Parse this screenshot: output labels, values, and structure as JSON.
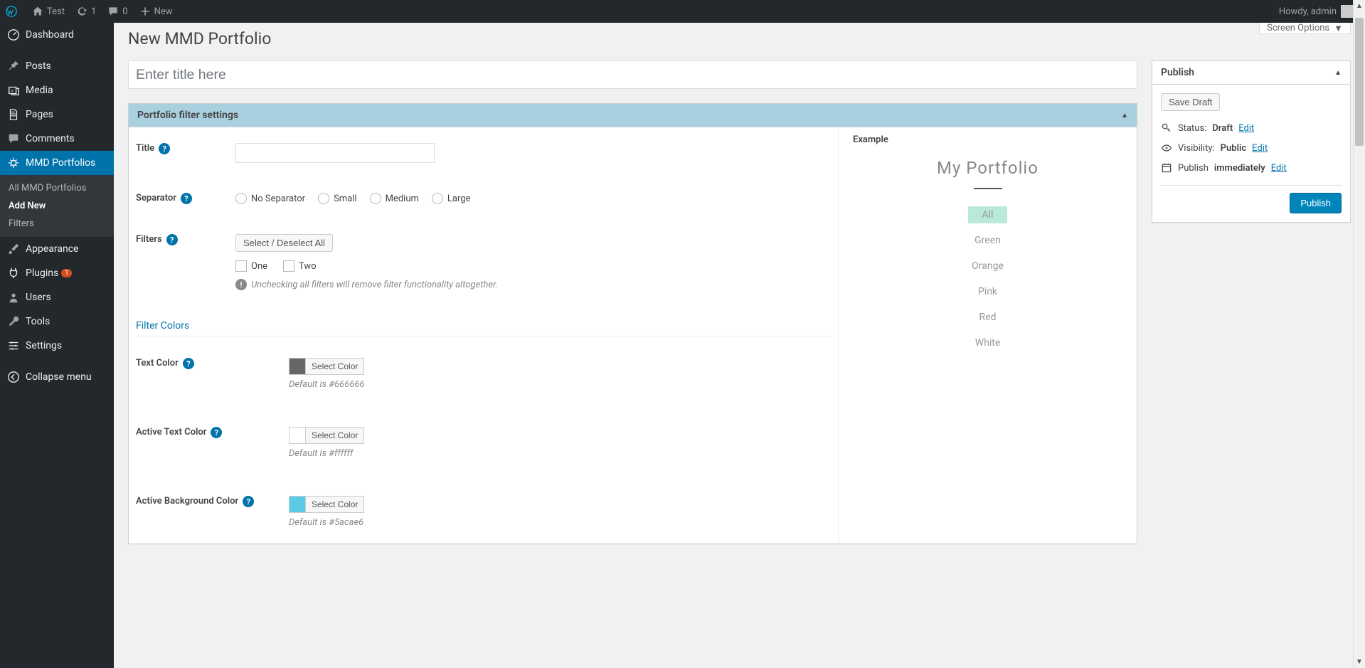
{
  "adminbar": {
    "site_name": "Test",
    "updates": "1",
    "comments": "0",
    "new_label": "New",
    "howdy": "Howdy, admin"
  },
  "menu": {
    "dashboard": "Dashboard",
    "posts": "Posts",
    "media": "Media",
    "pages": "Pages",
    "comments": "Comments",
    "mmd_portfolios": "MMD Portfolios",
    "appearance": "Appearance",
    "plugins": "Plugins",
    "plugins_badge": "1",
    "users": "Users",
    "tools": "Tools",
    "settings": "Settings",
    "collapse": "Collapse menu"
  },
  "submenu": {
    "all": "All MMD Portfolios",
    "add_new": "Add New",
    "filters": "Filters"
  },
  "page": {
    "title": "New MMD Portfolio",
    "title_placeholder": "Enter title here",
    "screen_options": "Screen Options"
  },
  "metabox": {
    "title": "Portfolio filter settings"
  },
  "settings": {
    "title_label": "Title",
    "separator_label": "Separator",
    "separator_opts": {
      "none": "No Separator",
      "small": "Small",
      "medium": "Medium",
      "large": "Large"
    },
    "filters_label": "Filters",
    "select_all_btn": "Select / Deselect All",
    "filter_one": "One",
    "filter_two": "Two",
    "filters_hint": "Unchecking all filters will remove filter functionality altogether.",
    "filter_colors_heading": "Filter Colors",
    "text_color_label": "Text Color",
    "active_text_label": "Active Text Color",
    "active_bg_label": "Active Background Color",
    "select_color_btn": "Select Color",
    "default_text_color": "Default is #666666",
    "default_active_text": "Default is #ffffff",
    "default_active_bg": "Default is #5acae6",
    "colors": {
      "text": "#666666",
      "active_text": "#ffffff",
      "active_bg": "#5acae6"
    }
  },
  "example": {
    "heading": "Example",
    "preview_title": "My Portfolio",
    "filters": [
      "All",
      "Green",
      "Orange",
      "Pink",
      "Red",
      "White"
    ]
  },
  "publish": {
    "box_title": "Publish",
    "save_draft": "Save Draft",
    "status_label": "Status:",
    "status_value": "Draft",
    "visibility_label": "Visibility:",
    "visibility_value": "Public",
    "publish_label": "Publish",
    "publish_value": "immediately",
    "edit": "Edit",
    "publish_btn": "Publish"
  }
}
